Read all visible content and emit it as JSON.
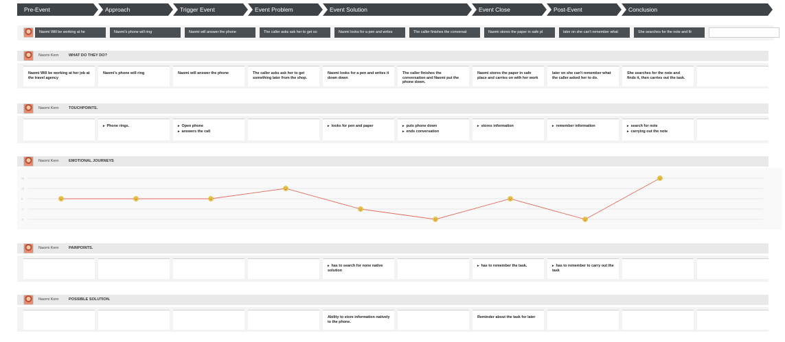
{
  "phases": [
    "Pre-Event",
    "Approach",
    "Trigger Event",
    "Event Problem",
    "Event Solution",
    "Event Close",
    "Post-Event",
    "Conclusion"
  ],
  "persona": {
    "name": "Naomi Kern"
  },
  "summary": [
    "Naomi Will be working at he",
    "Naomi's phone will ring",
    "Naomi will answer the phone",
    "The caller asks ask her to get so",
    "Naomi looks for a pen and writes",
    "The caller finishes the conversat",
    "Naomi stores the paper in safe pl",
    "later on she can't remember what",
    "She searches for the note and fir",
    ""
  ],
  "sections": {
    "doing": {
      "title": "WHAT DO THEY DO?",
      "cards": [
        "Naomi Will be working at her job at the travel agency",
        "Naomi's phone will ring",
        "Naomi will answer the phone",
        "The caller asks ask her to get something later from the shop.",
        "Naomi looks for a pen and writes it down down",
        "The caller finishes the conversation and Naomi put the phone down.",
        "Naomi stores the paper in safe place and carries on with her work",
        "later on she can't remember what the caller asked her to do.",
        "She searches for the note and finds it, then carries out the task.",
        ""
      ]
    },
    "touchpoints": {
      "title": "TOUCHPOINTS.",
      "cards": [
        [],
        [
          "Phone rings."
        ],
        [
          "Open phone",
          "answers the call"
        ],
        [],
        [
          "looks for pen and paper"
        ],
        [
          "puts phone down",
          "ends conversation"
        ],
        [
          "stores information"
        ],
        [
          "remember information"
        ],
        [
          "search for note",
          "carrying out the note"
        ],
        []
      ]
    },
    "emotions": {
      "title": "EMOTIONAL JOURNEYS"
    },
    "painpoints": {
      "title": "PAINPOINTS.",
      "cards": [
        [],
        [],
        [],
        [],
        [
          "has to search for none native solution"
        ],
        [],
        [
          "has to remember the task."
        ],
        [
          "has to remember to carry out the task"
        ],
        [],
        []
      ]
    },
    "solutions": {
      "title": "POSSIBLE SOLUTION.",
      "cards": [
        "",
        "",
        "",
        "",
        "Ability to store information natively to the phone.",
        "",
        "Reminder about the task for later",
        "",
        "",
        ""
      ]
    }
  },
  "chart_data": {
    "type": "line",
    "title": "",
    "yticks": [
      "+2",
      "+1",
      "0",
      "-1",
      "-2"
    ],
    "ylim": [
      -2,
      2
    ],
    "values": [
      0,
      0,
      0,
      1,
      -1,
      -2,
      0,
      -2,
      2
    ],
    "line_color": "#e26b5a",
    "marker": "smiley",
    "marker_color": "#f2c94c",
    "grid": true
  }
}
